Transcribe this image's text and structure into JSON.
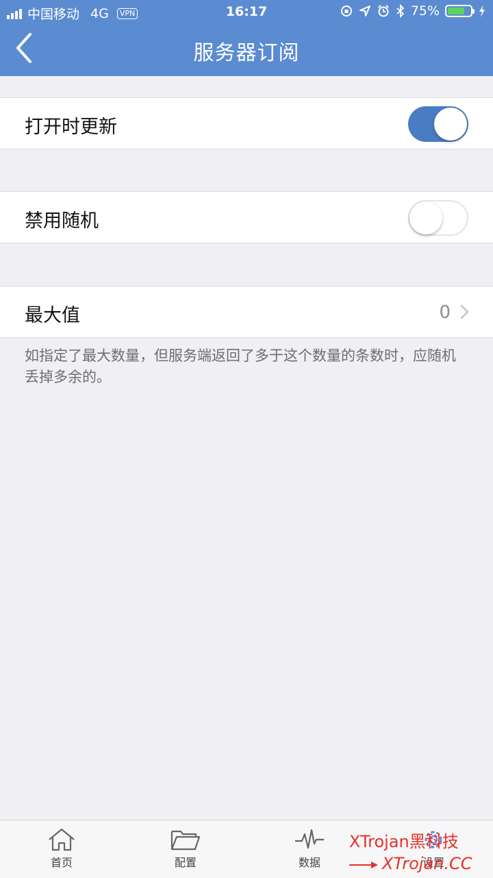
{
  "status_bar": {
    "carrier": "中国移动",
    "network": "4G",
    "vpn": "VPN",
    "time": "16:17",
    "battery_percent": "75%",
    "battery_level": 0.75
  },
  "header": {
    "title": "服务器订阅",
    "back_icon": "chevron-left-icon"
  },
  "settings": {
    "update_on_open": {
      "label": "打开时更新",
      "enabled": true
    },
    "disable_random": {
      "label": "禁用随机",
      "enabled": false
    },
    "max_value": {
      "label": "最大值",
      "value": "0"
    },
    "footnote": "如指定了最大数量，但服务端返回了多于这个数量的条数时，应随机丢掉多余的。"
  },
  "tabbar": {
    "items": [
      {
        "label": "首页",
        "icon": "home-icon"
      },
      {
        "label": "配置",
        "icon": "folder-icon"
      },
      {
        "label": "数据",
        "icon": "pulse-icon"
      },
      {
        "label": "设置",
        "icon": "gear-icon"
      }
    ]
  },
  "watermark": {
    "line1": "XTrojan黑科技",
    "line2": "XTrojan.CC"
  },
  "colors": {
    "header": "#5b8bd1",
    "switch_on": "#4a7cc4",
    "background": "#efeff4",
    "watermark": "#e8302b"
  }
}
